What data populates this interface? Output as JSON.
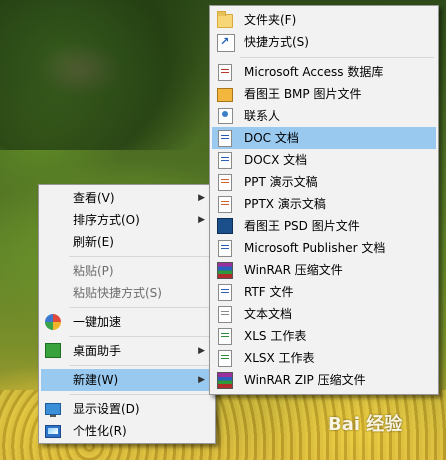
{
  "context_menu": {
    "items": [
      {
        "label": "查看(V)",
        "has_submenu": true
      },
      {
        "label": "排序方式(O)",
        "has_submenu": true
      },
      {
        "label": "刷新(E)",
        "has_submenu": false
      },
      {
        "label": "粘贴(P)",
        "disabled": true
      },
      {
        "label": "粘贴快捷方式(S)",
        "disabled": true
      },
      {
        "label": "一键加速",
        "icon": "speed-boost-icon"
      },
      {
        "label": "桌面助手",
        "icon": "desktop-helper-icon",
        "has_submenu": true
      },
      {
        "label": "新建(W)",
        "has_submenu": true,
        "highlighted": true
      },
      {
        "label": "显示设置(D)",
        "icon": "display-icon"
      },
      {
        "label": "个性化(R)",
        "icon": "personalize-icon"
      }
    ]
  },
  "new_submenu": {
    "items": [
      {
        "label": "文件夹(F)",
        "icon": "folder-icon"
      },
      {
        "label": "快捷方式(S)",
        "icon": "shortcut-icon"
      },
      {
        "label": "Microsoft Access 数据库",
        "icon": "access-file-icon"
      },
      {
        "label": "看图王 BMP 图片文件",
        "icon": "bmp-file-icon"
      },
      {
        "label": "联系人",
        "icon": "contact-file-icon"
      },
      {
        "label": "DOC 文档",
        "icon": "doc-file-icon",
        "highlighted": true
      },
      {
        "label": "DOCX 文档",
        "icon": "docx-file-icon"
      },
      {
        "label": "PPT 演示文稿",
        "icon": "ppt-file-icon"
      },
      {
        "label": "PPTX 演示文稿",
        "icon": "pptx-file-icon"
      },
      {
        "label": "看图王 PSD 图片文件",
        "icon": "psd-file-icon"
      },
      {
        "label": "Microsoft Publisher 文档",
        "icon": "publisher-file-icon"
      },
      {
        "label": "WinRAR 压缩文件",
        "icon": "winrar-file-icon"
      },
      {
        "label": "RTF 文件",
        "icon": "rtf-file-icon"
      },
      {
        "label": "文本文档",
        "icon": "text-file-icon"
      },
      {
        "label": "XLS 工作表",
        "icon": "xls-file-icon"
      },
      {
        "label": "XLSX 工作表",
        "icon": "xlsx-file-icon"
      },
      {
        "label": "WinRAR ZIP 压缩文件",
        "icon": "winrar-zip-file-icon"
      }
    ]
  },
  "colors": {
    "menu_bg": "#f2f2f2",
    "highlight": "#99c9ef",
    "border": "#979797"
  },
  "watermark": {
    "text": "Bai 经验"
  }
}
